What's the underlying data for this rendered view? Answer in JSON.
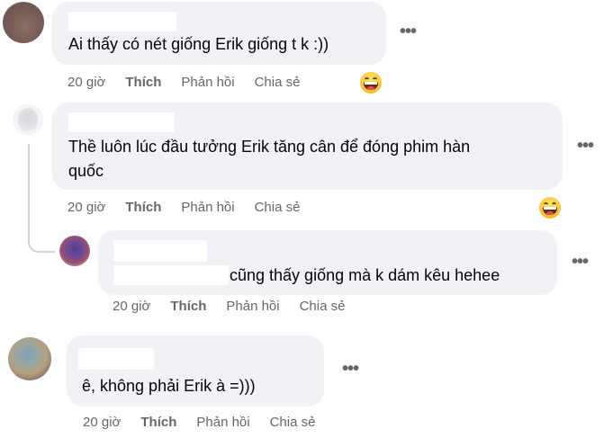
{
  "comments": [
    {
      "text_lines": [
        "Ai thấy có nét giống Erik giống t k :))"
      ],
      "time": "20 giờ",
      "like": "Thích",
      "reply": "Phản hồi",
      "share": "Chia sẻ",
      "more": "•••",
      "reaction": "grinning-squinting-face"
    },
    {
      "text_lines": [
        "Thề luôn lúc đầu tưởng Erik tăng cân để đóng phim hàn",
        "quốc"
      ],
      "time": "20 giờ",
      "like": "Thích",
      "reply": "Phản hồi",
      "share": "Chia sẻ",
      "more": "•••",
      "reaction": "grinning-squinting-face"
    },
    {
      "text_lines": [
        "cũng thấy giống mà k dám kêu hehee"
      ],
      "time": "20 giờ",
      "like": "Thích",
      "reply": "Phản hồi",
      "share": "Chia sẻ",
      "more": "•••"
    },
    {
      "text_lines": [
        "ê, không phải Erik à =)))"
      ],
      "time": "20 giờ",
      "like": "Thích",
      "reply": "Phản hồi",
      "share": "Chia sẻ",
      "more": "•••"
    }
  ],
  "colors": {
    "bubble": "#f0f2f5",
    "meta_text": "#65676b",
    "body_text": "#050505",
    "redaction": "#ffffff"
  }
}
